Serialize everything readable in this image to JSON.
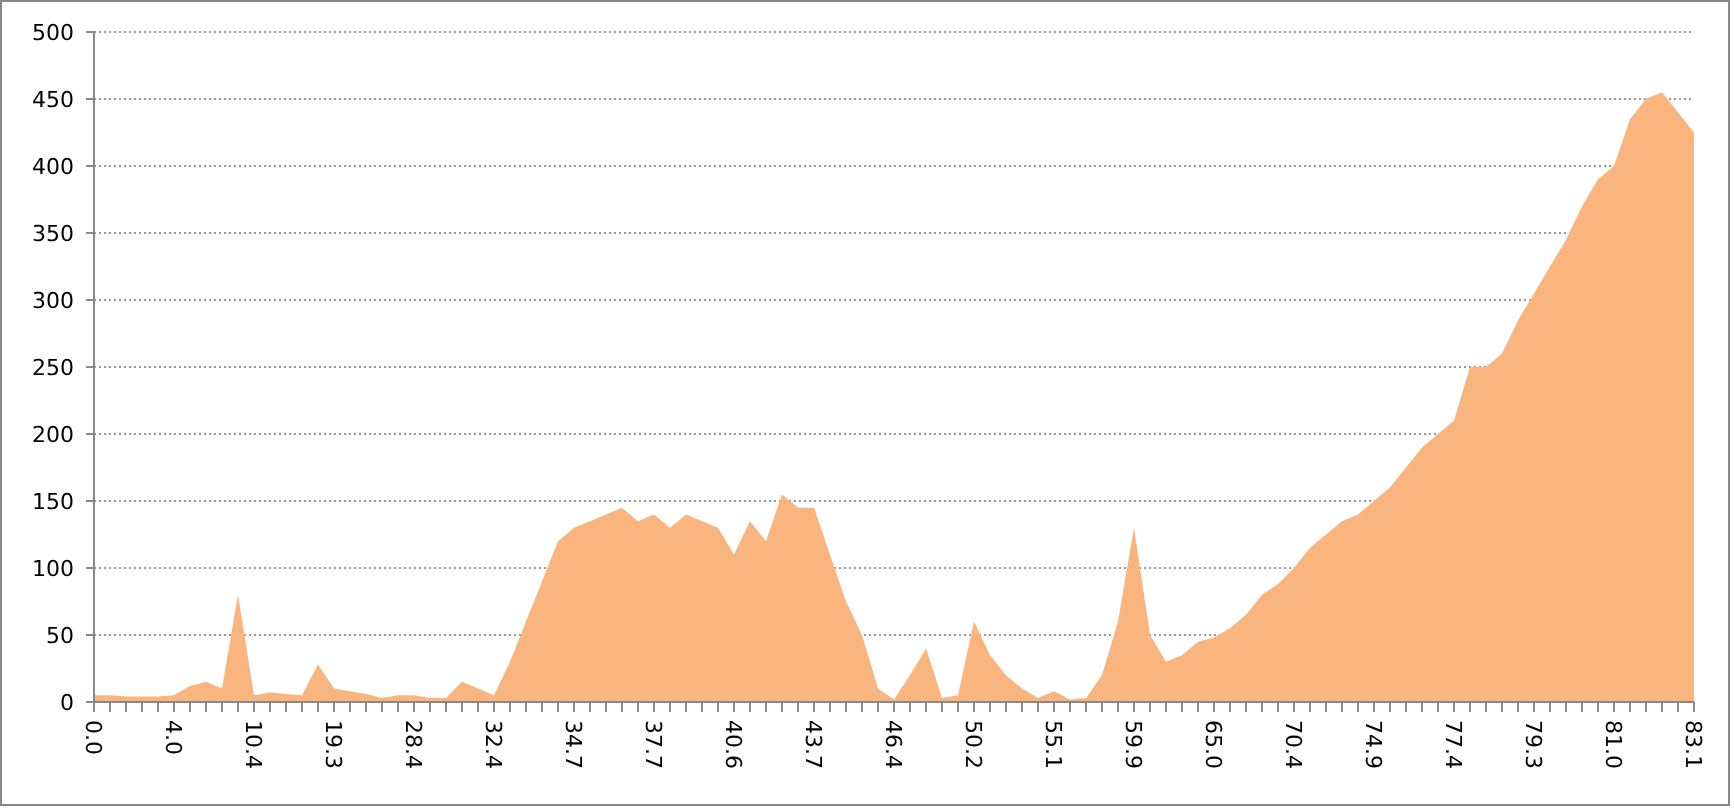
{
  "chart_data": {
    "type": "area",
    "categories": [
      "0.0",
      null,
      null,
      null,
      null,
      "4.0",
      null,
      null,
      null,
      null,
      "10.4",
      null,
      null,
      null,
      null,
      "19.3",
      null,
      null,
      null,
      null,
      "28.4",
      null,
      null,
      null,
      null,
      "32.4",
      null,
      null,
      null,
      null,
      "34.7",
      null,
      null,
      null,
      null,
      "37.7",
      null,
      null,
      null,
      null,
      "40.6",
      null,
      null,
      null,
      null,
      "43.7",
      null,
      null,
      null,
      null,
      "46.4",
      null,
      null,
      null,
      null,
      "50.2",
      null,
      null,
      null,
      null,
      "55.1",
      null,
      null,
      null,
      null,
      "59.9",
      null,
      null,
      null,
      null,
      "65.0",
      null,
      null,
      null,
      null,
      "70.4",
      null,
      null,
      null,
      null,
      "74.9",
      null,
      null,
      null,
      null,
      "77.4",
      null,
      null,
      null,
      null,
      "79.3",
      null,
      null,
      null,
      null,
      "81.0",
      null,
      null,
      null,
      null,
      "83.1"
    ],
    "series": [
      {
        "color": "#f9b57d",
        "values": [
          5,
          5,
          4,
          4,
          4,
          5,
          12,
          15,
          10,
          80,
          5,
          7,
          6,
          5,
          28,
          10,
          8,
          6,
          3,
          5,
          5,
          3,
          3,
          15,
          10,
          5,
          30,
          60,
          90,
          120,
          130,
          135,
          140,
          145,
          135,
          140,
          130,
          140,
          135,
          130,
          110,
          135,
          120,
          155,
          145,
          145,
          110,
          75,
          50,
          10,
          2,
          20,
          40,
          3,
          5,
          60,
          35,
          20,
          10,
          3,
          8,
          2,
          3,
          20,
          60,
          130,
          50,
          30,
          35,
          45,
          48,
          55,
          65,
          80,
          88,
          100,
          115,
          125,
          135,
          140,
          150,
          160,
          175,
          190,
          200,
          210,
          250,
          250,
          260,
          285,
          305,
          325,
          345,
          370,
          390,
          400,
          435,
          450,
          455,
          440,
          425
        ]
      }
    ],
    "ylim": [
      0,
      500
    ],
    "grid": true,
    "yticks": [
      0,
      50,
      100,
      150,
      200,
      250,
      300,
      350,
      400,
      450,
      500
    ]
  }
}
